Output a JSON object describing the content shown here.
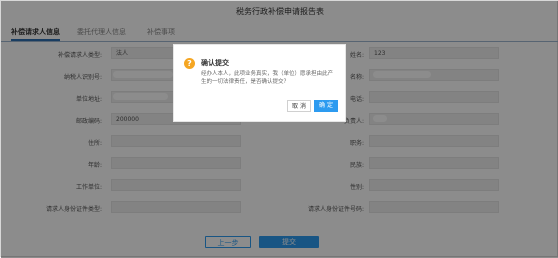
{
  "page": {
    "title": "税务行政补偿申请报告表"
  },
  "tabs": [
    {
      "label": "补偿请求人信息"
    },
    {
      "label": "委托代理人信息"
    },
    {
      "label": "补偿事项"
    }
  ],
  "form_left": [
    {
      "label": "补偿请求人类型:",
      "value": "法人"
    },
    {
      "label": "纳税人识别号:",
      "value": ""
    },
    {
      "label": "单位地址:",
      "value": ""
    },
    {
      "label": "邮政编码:",
      "value": "200000"
    },
    {
      "label": "住所:",
      "value": ""
    },
    {
      "label": "年龄:",
      "value": ""
    },
    {
      "label": "工作单位:",
      "value": ""
    },
    {
      "label": "请求人身份证件类型:",
      "value": ""
    }
  ],
  "form_right": [
    {
      "label": "姓名:",
      "value": "123"
    },
    {
      "label": "名称:",
      "value": ""
    },
    {
      "label": "电话:",
      "value": ""
    },
    {
      "label": "负责人:",
      "value": ""
    },
    {
      "label": "职务:",
      "value": ""
    },
    {
      "label": "民族:",
      "value": ""
    },
    {
      "label": "性别:",
      "value": ""
    },
    {
      "label": "请求人身份证件号码:",
      "value": ""
    }
  ],
  "footer": {
    "prev_label": "上一步",
    "submit_label": "提交"
  },
  "dialog": {
    "icon": "question-icon",
    "title": "确认提交",
    "message": "经办人本人，此项业务真实，我（单位）愿承担由此产生的一切法律责任，是否确认提交？",
    "cancel_label": "取 消",
    "confirm_label": "确 定"
  },
  "colors": {
    "primary": "#2d9bf0",
    "warning": "#f5a623",
    "tab_underline": "#2f6fb1"
  }
}
